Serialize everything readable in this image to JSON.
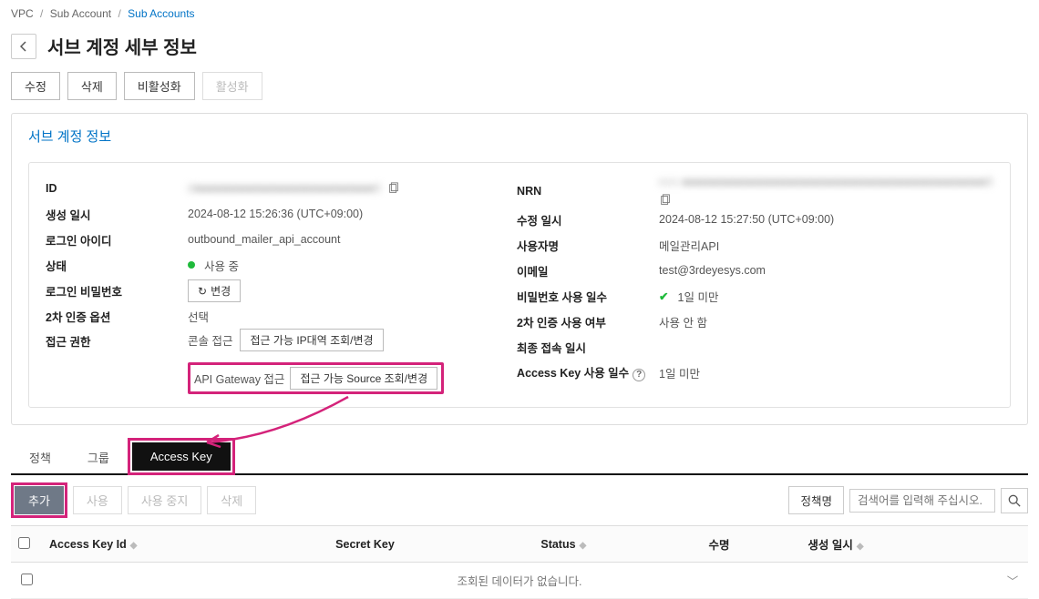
{
  "breadcrumb": {
    "a": "VPC",
    "b": "Sub Account",
    "c": "Sub Accounts"
  },
  "page_title": "서브 계정 세부 정보",
  "actions": {
    "edit": "수정",
    "delete": "삭제",
    "deactivate": "비활성화",
    "activate": "활성화"
  },
  "panel": {
    "title": "서브 계정 정보",
    "left": {
      "id_k": "ID",
      "id_v": "d■■■■■■■■■■■■■■■■■■■■■■■8",
      "created_k": "생성 일시",
      "created_v": "2024-08-12 15:26:36 (UTC+09:00)",
      "login_k": "로그인 아이디",
      "login_v": "outbound_mailer_api_account",
      "status_k": "상태",
      "status_v": "사용 중",
      "pw_k": "로그인 비밀번호",
      "pw_btn": "변경",
      "twofa_k": "2차 인증 옵션",
      "twofa_v": "선택",
      "access_k": "접근 권한",
      "access_console": "콘솔 접근",
      "access_ip_btn": "접근 가능 IP대역 조회/변경",
      "access_api": "API Gateway 접근",
      "access_src_btn": "접근 가능 Source 조회/변경"
    },
    "right": {
      "nrn_k": "NRN",
      "nrn_v": "nrn:■■■■■■■■■■■■■■■■■■■■■■■■■■■■■■■■■■■■■■■8",
      "mod_k": "수정 일시",
      "mod_v": "2024-08-12 15:27:50 (UTC+09:00)",
      "username_k": "사용자명",
      "username_v": "메일관리API",
      "email_k": "이메일",
      "email_v": "test@3rdeyesys.com",
      "pwdays_k": "비밀번호 사용 일수",
      "pwdays_v": "1일 미만",
      "twofa_use_k": "2차 인증 사용 여부",
      "twofa_use_v": "사용 안 함",
      "last_k": "최종 접속 일시",
      "last_v": "",
      "akdays_k": "Access Key 사용 일수",
      "akdays_v": "1일 미만"
    }
  },
  "tabs": {
    "policy": "정책",
    "group": "그룹",
    "access_key": "Access Key"
  },
  "toolbar2": {
    "add": "추가",
    "use": "사용",
    "stop_use": "사용 중지",
    "delete": "삭제",
    "search_label": "정책명",
    "search_placeholder": "검색어를 입력해 주십시오."
  },
  "table": {
    "h1": "Access Key Id",
    "h2": "Secret Key",
    "h3": "Status",
    "h4": "수명",
    "h5": "생성 일시",
    "empty": "조회된 데이터가 없습니다."
  }
}
